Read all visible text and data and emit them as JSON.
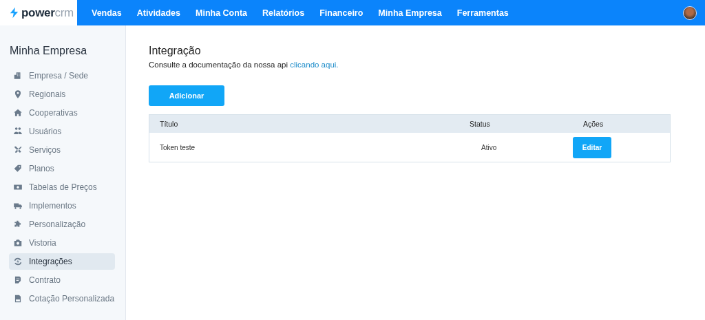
{
  "logo": {
    "text": "**power**crm"
  },
  "nav": [
    {
      "label": "Vendas"
    },
    {
      "label": "Atividades"
    },
    {
      "label": "Minha Conta"
    },
    {
      "label": "Relatórios"
    },
    {
      "label": "Financeiro"
    },
    {
      "label": "Minha Empresa"
    },
    {
      "label": "Ferramentas"
    }
  ],
  "sidebar": {
    "title": "Minha Empresa",
    "items": [
      {
        "label": "Empresa / Sede",
        "selected": false
      },
      {
        "label": "Regionais",
        "selected": false
      },
      {
        "label": "Cooperativas",
        "selected": false
      },
      {
        "label": "Usuários",
        "selected": false
      },
      {
        "label": "Serviços",
        "selected": false
      },
      {
        "label": "Planos",
        "selected": false
      },
      {
        "label": "Tabelas de Preços",
        "selected": false
      },
      {
        "label": "Implementos",
        "selected": false
      },
      {
        "label": "Personalização",
        "selected": false
      },
      {
        "label": "Vistoria",
        "selected": false
      },
      {
        "label": "Integrações",
        "selected": true
      },
      {
        "label": "Contrato",
        "selected": false
      },
      {
        "label": "Cotação Personalizada",
        "selected": false
      }
    ]
  },
  "page": {
    "title": "Integração",
    "description": "Consulte a documentação da nossa api",
    "link": "clicando aqui.",
    "add_button": "Adicionar"
  },
  "table": {
    "columns": [
      "Título",
      "Status",
      "Ações"
    ],
    "rows": [
      {
        "title": "Token teste",
        "status": "Ativo",
        "action": "Editar"
      }
    ]
  }
}
